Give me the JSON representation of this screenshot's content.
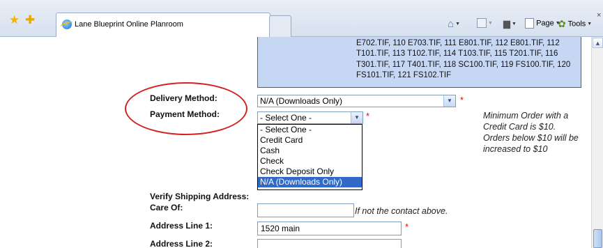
{
  "browser": {
    "tab_title": "Lane Blueprint Online Planroom",
    "page_menu": "Page",
    "tools_menu": "Tools"
  },
  "files": {
    "text": "E702.TIF, 110 E703.TIF, 111 E801.TIF, 112 E801.TIF, 112 T101.TIF, 113 T102.TIF, 114 T103.TIF, 115 T201.TIF, 116 T301.TIF, 117 T401.TIF, 118 SC100.TIF, 119 FS100.TIF, 120 FS101.TIF, 121 FS102.TIF"
  },
  "form": {
    "delivery_label": "Delivery Method:",
    "delivery_value": "N/A (Downloads Only)",
    "payment_label": "Payment Method:",
    "payment_value": "- Select One -",
    "required_mark": "*",
    "payment_options": [
      "- Select One -",
      "Credit Card",
      "Cash",
      "Check",
      "Check Deposit Only",
      "N/A (Downloads Only)"
    ],
    "highlighted_option": "N/A (Downloads Only)",
    "min_order_note": "Minimum Order with a Credit Card is $10. Orders below $10 will be increased to $10",
    "verify_label": "Verify Shipping Address:",
    "care_of_label": "Care Of:",
    "care_of_value": "",
    "care_of_hint": "If not the contact above.",
    "address1_label": "Address Line 1:",
    "address1_value": "1520 main",
    "address2_label": "Address Line 2:",
    "address2_value": ""
  },
  "colors": {
    "annotation": "#d42121",
    "file_box": "#c6d7f4",
    "selection": "#316ac5"
  }
}
